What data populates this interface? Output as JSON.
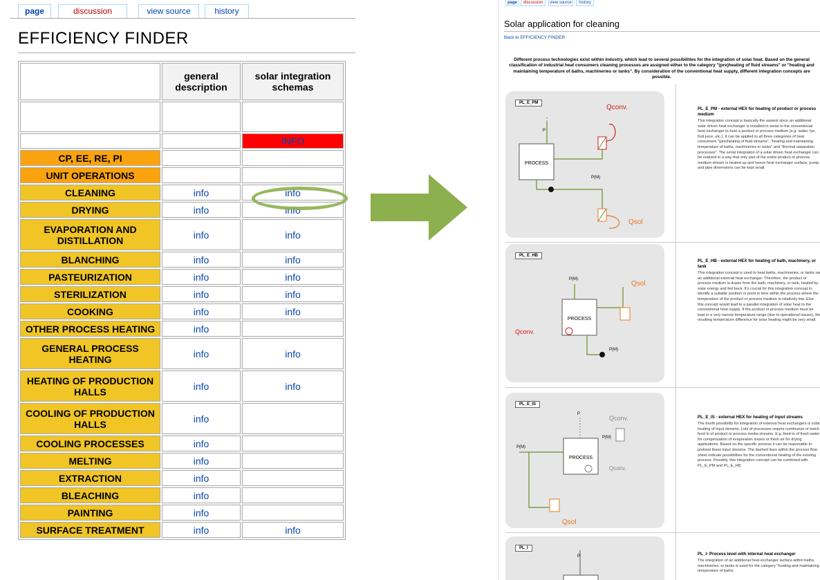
{
  "left": {
    "tabs": [
      "page",
      "discussion",
      "view source",
      "history"
    ],
    "title": "EFFICIENCY FINDER",
    "headers": [
      "general description",
      "solar integration schemas"
    ],
    "info_box": "INFO",
    "rows": [
      {
        "label": "CP, EE, RE, PI",
        "general": "",
        "solar": "",
        "style": "orange"
      },
      {
        "label": "UNIT OPERATIONS",
        "general": "",
        "solar": "",
        "style": "orange"
      },
      {
        "label": "CLEANING",
        "general": "info",
        "solar": "info",
        "style": "yellow"
      },
      {
        "label": "DRYING",
        "general": "info",
        "solar": "info",
        "style": "yellow"
      },
      {
        "label": "EVAPORATION AND DISTILLATION",
        "general": "info",
        "solar": "info",
        "style": "yellow",
        "tall": true
      },
      {
        "label": "BLANCHING",
        "general": "info",
        "solar": "info",
        "style": "yellow"
      },
      {
        "label": "PASTEURIZATION",
        "general": "info",
        "solar": "info",
        "style": "yellow"
      },
      {
        "label": "STERILIZATION",
        "general": "info",
        "solar": "info",
        "style": "yellow"
      },
      {
        "label": "COOKING",
        "general": "info",
        "solar": "info",
        "style": "yellow"
      },
      {
        "label": "OTHER PROCESS HEATING",
        "general": "info",
        "solar": "",
        "style": "yellow"
      },
      {
        "label": "GENERAL PROCESS HEATING",
        "general": "info",
        "solar": "info",
        "style": "yellow",
        "tall": true
      },
      {
        "label": "HEATING OF PRODUCTION HALLS",
        "general": "info",
        "solar": "info",
        "style": "yellow",
        "tall": true
      },
      {
        "label": "COOLING OF PRODUCTION HALLS",
        "general": "info",
        "solar": "",
        "style": "yellow",
        "tall": true
      },
      {
        "label": "COOLING PROCESSES",
        "general": "info",
        "solar": "",
        "style": "yellow"
      },
      {
        "label": "MELTING",
        "general": "info",
        "solar": "",
        "style": "yellow"
      },
      {
        "label": "EXTRACTION",
        "general": "info",
        "solar": "",
        "style": "yellow"
      },
      {
        "label": "BLEACHING",
        "general": "info",
        "solar": "",
        "style": "yellow"
      },
      {
        "label": "PAINTING",
        "general": "info",
        "solar": "",
        "style": "yellow"
      },
      {
        "label": "SURFACE TREATMENT",
        "general": "info",
        "solar": "info",
        "style": "yellow"
      }
    ]
  },
  "right": {
    "tabs": [
      "page",
      "discussion",
      "view source",
      "history"
    ],
    "title": "Solar application for cleaning",
    "back_link": "Back to EFFICIENCY FINDER",
    "intro": "Different process technologies exist within industry, which lead to several possibilities for the integration of solar heat. Based on the general classification of industrial heat consumers cleaning processes are assigned either to the category \"(pre)heating of fluid streams\" or \"heating and maintaining temperature of baths, machineries or tanks\". By consideration of the conventional heat supply, different integration concepts are possible.",
    "diagram_labels": {
      "process": "PROCESS",
      "qconv": "Qconv.",
      "qsol": "Qsol",
      "p": "P",
      "pm": "P(M)"
    },
    "schemas": [
      {
        "label": "PL_E_PM",
        "heading": "PL_E_PM - external HEX for heating of product or process medium",
        "text": "This integration concept is basically the easiest since an additional solar driven heat exchanger is installed in serial to the conventional heat exchanger to heat a product or process medium (e.g. water, lye, fruit juice, etc.). It can be applied to all three categories of heat consumers \"(pre)heating of fluid streams\", \"heating and maintaining temperature of baths, machineries or tanks\" and \"thermal separation processes\". The serial integration of a solar driven heat exchanger can be realized in a way that only part of the entire product or process medium stream is heated up and hence heat exchanger surface, pump and pipe dimensions can be kept small."
      },
      {
        "label": "PL_E_HB",
        "heading": "PL_E_HB - external HEX for heating of bath, machinery, or tank",
        "text": "This integration concept is used to heat baths, machineries, or tanks via an additional external heat exchanger. Therefore, the product or process medium is drawn from the bath, machinery, or tank, heated by solar energy and fed back. It's crucial for this integration concept to identify a suitable position or point in time within the process where the temperature of the product or process medium is relatively low. Else this concept would lead to a parallel integration of solar heat to the conventional heat supply. If the product or process medium must be kept in a very narrow temperature range (due to operational issues), the resulting temperature difference for solar heating might be very small."
      },
      {
        "label": "PL_E_IS",
        "heading": "PL_E_IS - external HEX for heating of input streams",
        "text": "The fourth possibility for integration of external heat exchangers is solar heating of input streams. Lots of processes require continuous or batch feed in of product or process media streams. E.g. feed-in of fresh water for compensation of evaporation losses or fresh air for drying applications. Based on the specific process it can be reasonable to preheat these input streams. The dashed lines within the process flow sheet indicate possibilities for the conventional heating of the existing process. Possibly, this integration concept can be combined with PL_E_PM and PL_E_HB."
      },
      {
        "label": "PL_I",
        "heading": "PL_I- Process level with internal heat exchanger",
        "text": "The integration of an additional heat exchanger surface within baths, machineries, or tanks is used for the category \"heating and maintaining temperature of baths"
      }
    ]
  },
  "colors": {
    "orange": "#fba30e",
    "yellow": "#f0c525",
    "info_red": "#ff0000",
    "highlight_ring": "#8cb04e",
    "arrow": "#8cb04e",
    "pipe_green": "#6b8e23",
    "solar_orange": "#e87722",
    "conv_red": "#d7191c"
  }
}
